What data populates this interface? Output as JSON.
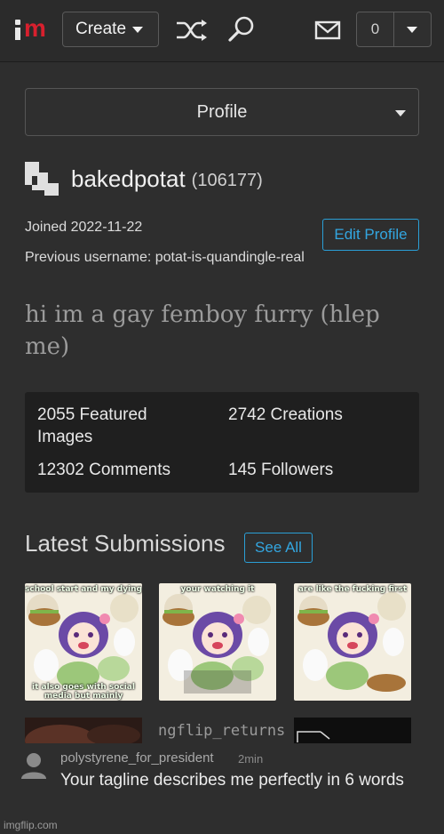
{
  "nav": {
    "logo_letters": "im",
    "create_label": "Create",
    "notifications_count": "0",
    "icons": [
      "shuffle-icon",
      "search-icon",
      "mail-icon",
      "chevron-down-icon"
    ]
  },
  "profile_dropdown": {
    "label": "Profile"
  },
  "user": {
    "username": "bakedpotat",
    "points": "(106177)",
    "joined": "Joined 2022-11-22",
    "previous_username": "Previous username: potat-is-quandingle-real",
    "edit_profile_label": "Edit Profile",
    "tagline": "hi im a gay femboy furry (hlep me)"
  },
  "stats": {
    "featured_images": "2055 Featured Images",
    "creations": "2742 Creations",
    "comments": "12302 Comments",
    "followers": "145 Followers"
  },
  "latest": {
    "title": "Latest Submissions",
    "see_all_label": "See All",
    "thumbnails": [
      {
        "top_caption": "school start and my dying",
        "bottom_caption": "it also goes with social media but mainly"
      },
      {
        "top_caption": "your watching it",
        "bottom_caption": ""
      },
      {
        "top_caption": "are like the fucking first",
        "bottom_caption": ""
      }
    ],
    "row2_text": "ngflip_returns"
  },
  "comment": {
    "author": "polystyrene_for_president",
    "time": "2min",
    "text": "Your tagline describes me perfectly in 6 words"
  },
  "footer": {
    "watermark": "imgflip.com"
  },
  "colors": {
    "background": "#2e2e2e",
    "accent_blue": "#2a9fd6",
    "logo_red": "#d8202e",
    "stats_bg": "#1f1f1f"
  }
}
